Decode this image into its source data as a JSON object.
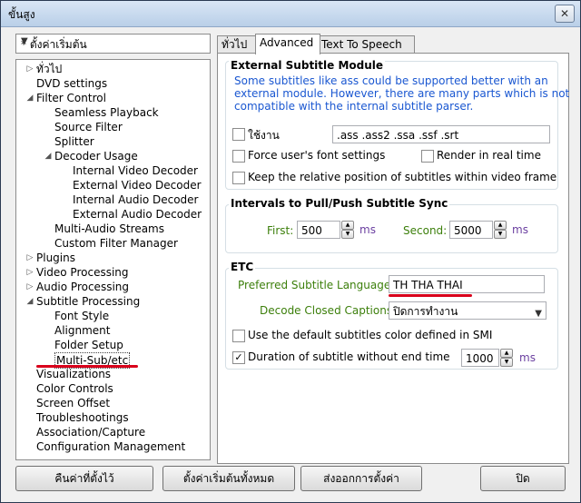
{
  "window": {
    "title": "ขั้นสูง",
    "close_label": "✕"
  },
  "preset": {
    "selected": "* ตั้งค่าเริ่มต้น"
  },
  "tree": [
    {
      "label": "ทั่วไป",
      "level": 0,
      "exp": "▷"
    },
    {
      "label": "DVD settings",
      "level": 0,
      "exp": ""
    },
    {
      "label": "Filter Control",
      "level": 0,
      "exp": "◢"
    },
    {
      "label": "Seamless Playback",
      "level": 1,
      "exp": ""
    },
    {
      "label": "Source Filter",
      "level": 1,
      "exp": ""
    },
    {
      "label": "Splitter",
      "level": 1,
      "exp": ""
    },
    {
      "label": "Decoder Usage",
      "level": 1,
      "exp": "◢"
    },
    {
      "label": "Internal Video Decoder",
      "level": 2,
      "exp": ""
    },
    {
      "label": "External Video Decoder",
      "level": 2,
      "exp": ""
    },
    {
      "label": "Internal Audio Decoder",
      "level": 2,
      "exp": ""
    },
    {
      "label": "External Audio Decoder",
      "level": 2,
      "exp": ""
    },
    {
      "label": "Multi-Audio Streams",
      "level": 1,
      "exp": ""
    },
    {
      "label": "Custom Filter Manager",
      "level": 1,
      "exp": ""
    },
    {
      "label": "Plugins",
      "level": 0,
      "exp": "▷"
    },
    {
      "label": "Video Processing",
      "level": 0,
      "exp": "▷"
    },
    {
      "label": "Audio Processing",
      "level": 0,
      "exp": "▷"
    },
    {
      "label": "Subtitle Processing",
      "level": 0,
      "exp": "◢"
    },
    {
      "label": "Font Style",
      "level": 1,
      "exp": ""
    },
    {
      "label": "Alignment",
      "level": 1,
      "exp": ""
    },
    {
      "label": "Folder Setup",
      "level": 1,
      "exp": ""
    },
    {
      "label": "Multi-Sub/etc",
      "level": 1,
      "exp": "",
      "selected": true
    },
    {
      "label": "Visualizations",
      "level": 0,
      "exp": ""
    },
    {
      "label": "Color Controls",
      "level": 0,
      "exp": ""
    },
    {
      "label": "Screen Offset",
      "level": 0,
      "exp": ""
    },
    {
      "label": "Troubleshootings",
      "level": 0,
      "exp": ""
    },
    {
      "label": "Association/Capture",
      "level": 0,
      "exp": ""
    },
    {
      "label": "Configuration Management",
      "level": 0,
      "exp": ""
    }
  ],
  "tabs": [
    "ทั่วไป",
    "Advanced",
    "Text To Speech"
  ],
  "ext": {
    "title": "External Subtitle Module",
    "desc": [
      "Some subtitles like ass could be supported better with an",
      "external module. However, there are many parts which is not",
      "compatible with the internal subtitle parser."
    ],
    "use_label": "ใช้งาน",
    "extensions": ".ass .ass2 .ssa .ssf .srt",
    "force_font": "Force user's font settings",
    "realtime": "Render in real time",
    "keep_pos": "Keep the relative position of subtitles within video frame"
  },
  "sync": {
    "title": "Intervals to Pull/Push Subtitle Sync",
    "first_label": "First:",
    "first_value": "500",
    "second_label": "Second:",
    "second_value": "5000",
    "unit": "ms"
  },
  "etc": {
    "title": "ETC",
    "lang_label": "Preferred Subtitle Language:",
    "lang_value": "TH THA THAI",
    "cc_label": "Decode Closed Captions:",
    "cc_value": "ปิดการทำงาน",
    "smi_label": "Use the default subtitles color defined in SMI",
    "duration_label": "Duration of subtitle without end time",
    "duration_value": "1000",
    "duration_unit": "ms"
  },
  "buttons": {
    "reset": "คืนค่าที่ตั้งไว้",
    "defaults": "ตั้งค่าเริ่มต้นทั้งหมด",
    "export": "ส่งออกการตั้งค่า",
    "close": "ปิด"
  },
  "colors": {
    "annotation": "#d9001b",
    "link_blue": "#1a57d1",
    "label_green": "#3c7f0b"
  }
}
